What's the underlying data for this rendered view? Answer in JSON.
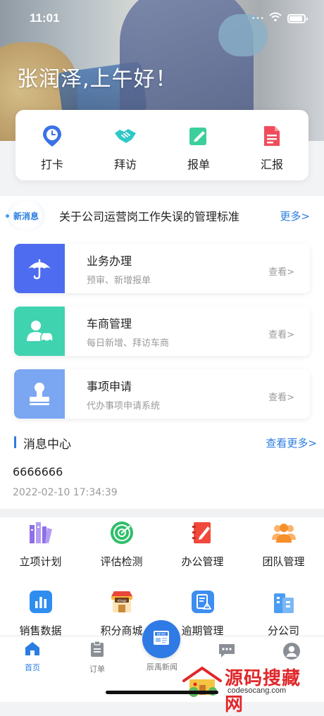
{
  "status": {
    "time": "11:01"
  },
  "greeting": "张润泽,上午好！",
  "quick_actions": [
    {
      "label": "打卡",
      "icon": "clock-pin-icon"
    },
    {
      "label": "拜访",
      "icon": "handshake-icon"
    },
    {
      "label": "报单",
      "icon": "edit-doc-icon"
    },
    {
      "label": "汇报",
      "icon": "report-doc-icon"
    }
  ],
  "news": {
    "badge": "新消息",
    "text": "关于公司运营岗工作失误的管理标准",
    "more": "更多>"
  },
  "business": [
    {
      "title": "业务办理",
      "sub": "预审、新增报单",
      "view": "查看>",
      "color": "#4e6cf0",
      "icon": "umbrella-icon"
    },
    {
      "title": "车商管理",
      "sub": "每日新增、拜访车商",
      "view": "查看>",
      "color": "#3fd3b0",
      "icon": "person-car-icon"
    },
    {
      "title": "事项申请",
      "sub": "代办事项申请系统",
      "view": "查看>",
      "color": "#7aa6f2",
      "icon": "stamp-icon"
    }
  ],
  "message_center": {
    "title": "消息中心",
    "more": "查看更多>",
    "item_title": "6666666",
    "item_time": "2022-02-10 17:34:39"
  },
  "functions": [
    {
      "label": "立项计划",
      "icon": "plan-icon"
    },
    {
      "label": "评估检测",
      "icon": "radar-icon"
    },
    {
      "label": "办公管理",
      "icon": "notebook-icon"
    },
    {
      "label": "团队管理",
      "icon": "team-icon"
    },
    {
      "label": "销售数据",
      "icon": "bar-chart-icon"
    },
    {
      "label": "积分商城",
      "icon": "shop-icon"
    },
    {
      "label": "逾期管理",
      "icon": "overdue-doc-icon"
    },
    {
      "label": "分公司",
      "icon": "building-icon"
    }
  ],
  "shop_sign": "shop",
  "tabs": [
    {
      "label": "首页",
      "icon": "home-icon"
    },
    {
      "label": "订单",
      "icon": "clipboard-icon"
    },
    {
      "label": "辰禹新闻",
      "icon": "news-icon"
    },
    {
      "label": "message-icon"
    },
    {
      "label": "profile-icon"
    }
  ],
  "center_tab_label": "辰禹新闻",
  "center_badge": "NEWS",
  "watermark": {
    "text": "源码搜藏网",
    "url": "codesocang.com"
  },
  "colors": {
    "accent": "#2a7de1",
    "red": "#e0272a"
  }
}
